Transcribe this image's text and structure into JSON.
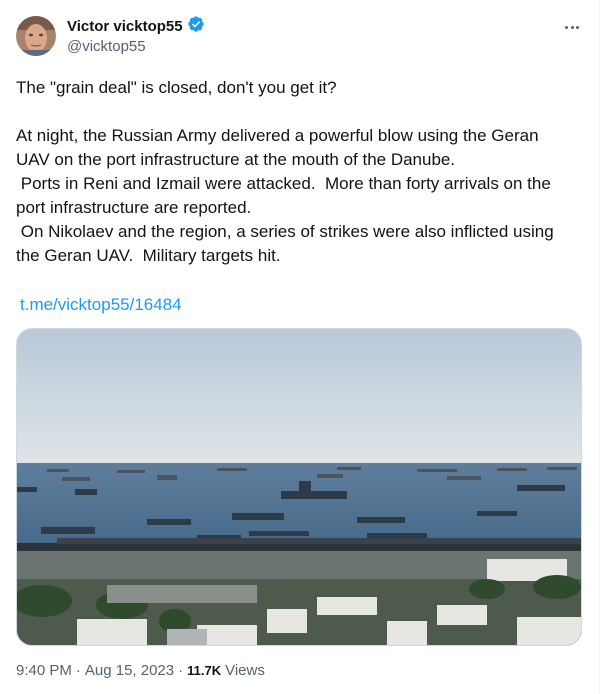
{
  "author": {
    "display_name": "Victor vicktop55",
    "handle": "@vicktop55",
    "verified": true,
    "verified_color": "#1d9bf0"
  },
  "more_menu_icon": "more-horizontal-icon",
  "tweet": {
    "line1": "The \"grain deal\" is closed, don't you get it?",
    "line2": "At night, the Russian Army delivered a powerful blow using the Geran UAV on the port infrastructure at the mouth of the Danube.\n Ports in Reni and Izmail were attacked.  More than forty arrivals on the port infrastructure are reported.\n On Nikolaev and the region, a series of strikes were also inflicted using the Geran UAV.  Military targets hit.",
    "link": "t.me/vicktop55/16484",
    "link_color": "#1d9bf0"
  },
  "media": {
    "alt_icon": "photo-harbor-with-ships"
  },
  "footer": {
    "time": "9:40 PM",
    "date": "Aug 15, 2023",
    "views_count": "11.7K",
    "views_label": "Views"
  }
}
